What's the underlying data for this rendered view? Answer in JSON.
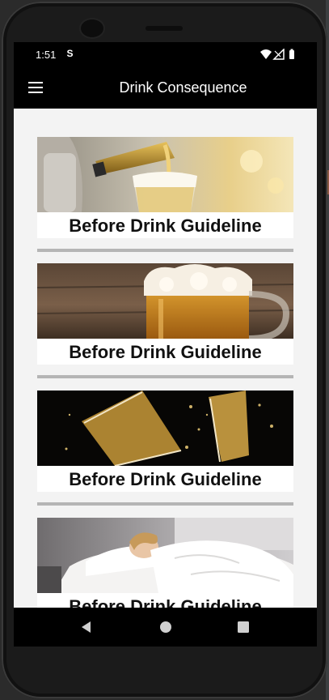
{
  "status_bar": {
    "time": "1:51",
    "sync_icon": "S",
    "icons": [
      "wifi-icon",
      "signal-icon",
      "battery-icon"
    ]
  },
  "app_bar": {
    "title": "Drink Consequence",
    "menu_icon": "hamburger-menu-icon"
  },
  "cards": [
    {
      "label": "Before Drink Guideline",
      "image": "beer-pouring-into-glass"
    },
    {
      "label": "Before Drink Guideline",
      "image": "beer-mug-on-wood"
    },
    {
      "label": "Before Drink Guideline",
      "image": "champagne-glasses-splash"
    },
    {
      "label": "Before Drink Guideline",
      "image": "person-sleeping-in-bed"
    }
  ],
  "nav_bar": {
    "icons": [
      "back-icon",
      "home-icon",
      "recents-icon"
    ]
  },
  "colors": {
    "app_bar": "#000000",
    "content_background": "#f3f3f3",
    "divider": "#b5b5b5",
    "caption_text": "#111111"
  }
}
